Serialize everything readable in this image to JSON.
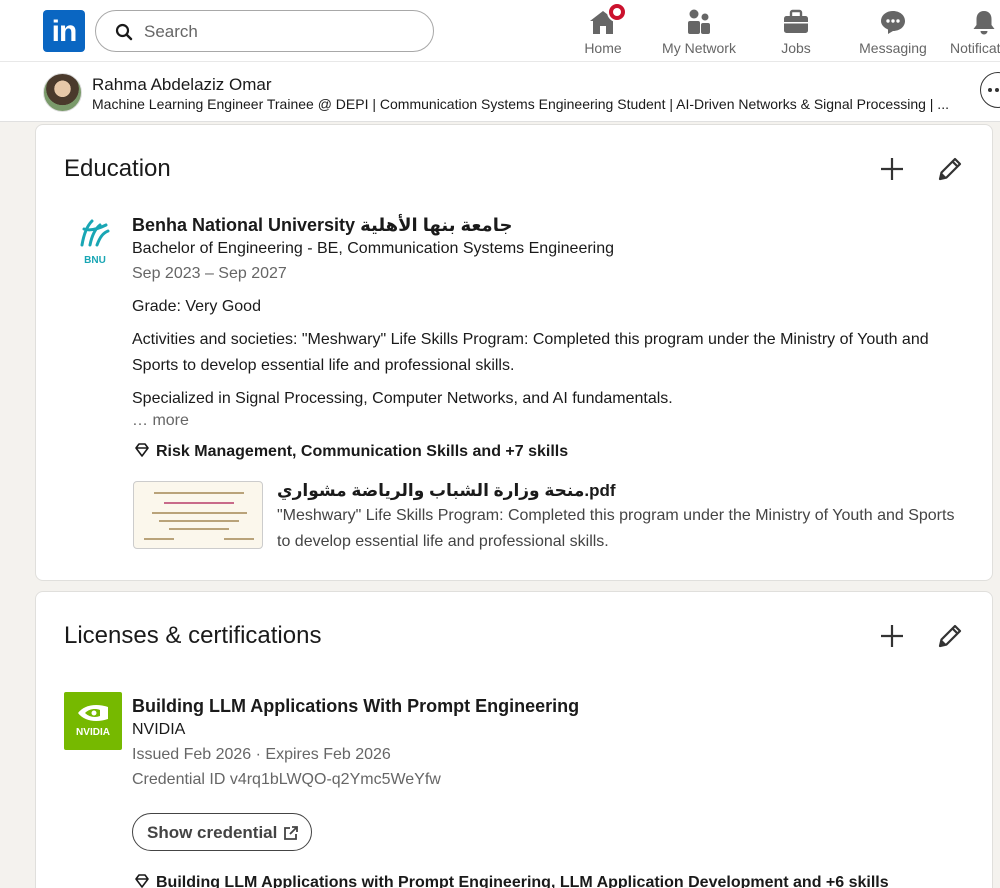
{
  "nav": {
    "search_placeholder": "Search",
    "items": [
      {
        "label": "Home",
        "icon": "home-icon",
        "notification": true
      },
      {
        "label": "My Network",
        "icon": "network-icon"
      },
      {
        "label": "Jobs",
        "icon": "briefcase-icon"
      },
      {
        "label": "Messaging",
        "icon": "messaging-icon"
      },
      {
        "label": "Notifications",
        "icon": "bell-icon"
      }
    ]
  },
  "profile_bar": {
    "name": "Rahma Abdelaziz Omar",
    "headline": "Machine Learning Engineer Trainee @ DEPI | Communication Systems Engineering Student | AI-Driven Networks & Signal Processing | ..."
  },
  "education": {
    "title": "Education",
    "entry": {
      "school": "Benha National University جامعة بنها الأهلية",
      "logo_text": "BNU",
      "degree": "Bachelor of Engineering - BE, Communication Systems Engineering",
      "dates": "Sep 2023 – Sep 2027",
      "grade": "Grade: Very Good",
      "activities": "Activities and societies: \"Meshwary\" Life Skills Program: Completed this program under the Ministry of Youth and Sports to develop essential life and professional skills.",
      "description": "Specialized in Signal Processing, Computer Networks, and AI fundamentals.",
      "more": "… more",
      "skills": "Risk Management, Communication Skills and +7 skills",
      "media": {
        "title": "منحة وزارة الشباب والرياضة مشواري.pdf",
        "description": "\"Meshwary\" Life Skills Program: Completed this program under the Ministry of Youth and Sports to develop essential life and professional skills."
      }
    }
  },
  "licenses": {
    "title": "Licenses & certifications",
    "entry": {
      "name": "Building LLM Applications With Prompt Engineering",
      "issuer": "NVIDIA",
      "logo_text": "NVIDIA",
      "dates": "Issued Feb 2026 · Expires Feb 2026",
      "credential_id": "Credential ID v4rq1bLWQO-q2Ymc5WeYfw",
      "show_credential": "Show credential",
      "skills": "Building LLM Applications with Prompt Engineering, LLM Application Development and +6 skills"
    }
  },
  "colors": {
    "brand": "#0a66c2",
    "nvidia": "#76b900",
    "badge": "#cb112d",
    "background": "#f4f2ee"
  }
}
